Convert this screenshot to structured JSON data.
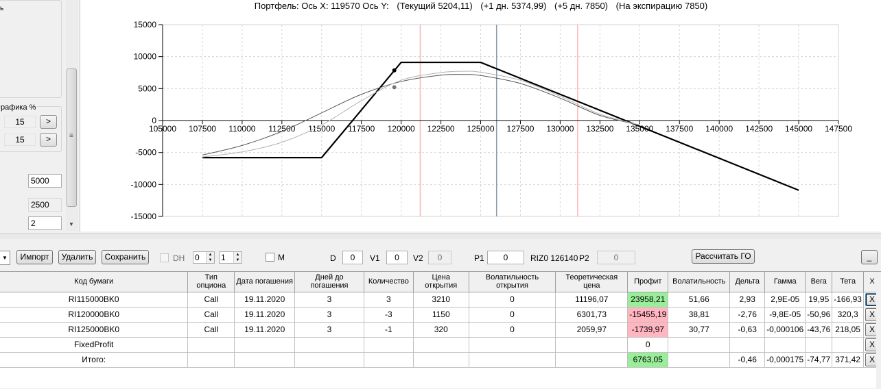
{
  "left_panel": {
    "truncated_label": "ь",
    "group_title": "рафика %",
    "row1_value": "15",
    "row2_value": "15",
    "arrow_label": ">",
    "input1": "5000",
    "input2": "2500",
    "input3": "2",
    "grip": "≡",
    "scroll_down": "▼"
  },
  "chart": {
    "title_parts": [
      "Портфель: Ось X: 119570 Ось Y:",
      "(Текущий 5204,11)",
      "(+1 дн. 5374,99)",
      "(+5 дн. 7850)",
      "(На экспирацию 7850)"
    ]
  },
  "chart_data": {
    "type": "line",
    "title": "Портфель: Ось X: 119570 Ось Y:  (Текущий 5204,11)  (+1 дн. 5374,99)  (+5 дн. 7850)  (На экспирацию 7850)",
    "xlim": [
      105000,
      147500
    ],
    "ylim": [
      -15000,
      15000
    ],
    "x_ticks": [
      "105000",
      "107500",
      "110000",
      "112500",
      "115000",
      "117500",
      "120000",
      "122500",
      "125000",
      "127500",
      "130000",
      "132500",
      "135000",
      "137500",
      "140000",
      "142500",
      "145000",
      "147500"
    ],
    "y_ticks": [
      "15000",
      "10000",
      "5000",
      "0",
      "-5000",
      "-10000",
      "-15000"
    ],
    "grid": true,
    "vertical_markers": [
      {
        "x": 121200,
        "color": "#ffb3b3"
      },
      {
        "x": 126000,
        "color": "#8899aa"
      },
      {
        "x": 131100,
        "color": "#ffb3b3"
      }
    ],
    "series": [
      {
        "color": "#000000",
        "width": 2.2,
        "x": [
          107500,
          115000,
          120000,
          125000,
          145000
        ],
        "y": [
          -5800,
          -5800,
          9100,
          9100,
          -10900
        ]
      },
      {
        "color": "#555555",
        "width": 1,
        "x": [
          107500,
          110000,
          112500,
          115000,
          117500,
          120000,
          122500,
          124000,
          125000,
          127500,
          130000,
          132500,
          135000
        ],
        "y": [
          -5400,
          -3900,
          -1700,
          1200,
          4100,
          6100,
          7100,
          7200,
          7050,
          5800,
          3500,
          800,
          -700
        ]
      },
      {
        "color": "#b0b0b0",
        "width": 1,
        "x": [
          107500,
          110000,
          112500,
          115000,
          117500,
          120000,
          122500,
          124000,
          125000,
          127500,
          130000,
          132500,
          135000
        ],
        "y": [
          -5700,
          -4900,
          -3400,
          -700,
          3100,
          6300,
          7500,
          7700,
          7550,
          6300,
          3800,
          1000,
          -700
        ]
      }
    ],
    "points": [
      {
        "x": 119570,
        "y": 7850,
        "color": "#000000"
      },
      {
        "x": 119570,
        "y": 5204.11,
        "color": "#777777"
      }
    ]
  },
  "toolbar": {
    "dropdown_arrow": "▼",
    "import": "Импорт",
    "delete": "Удалить",
    "save": "Сохранить",
    "dh_label": "DH",
    "spin1": "0",
    "spin2": "1",
    "spin_up": "▲",
    "spin_down": "▼",
    "m_label": "M",
    "d_label": "D",
    "d_value": "0",
    "v1_label": "V1",
    "v1_value": "0",
    "v2_label": "V2",
    "v2_value": "0",
    "p1_label": "P1",
    "p1_value": "0",
    "riz_label": "RIZ0 126140",
    "p2_label": "P2",
    "p2_value": "0",
    "calc": "Рассчитать ГО",
    "minimize": "_"
  },
  "table": {
    "headers": [
      "Код бумаги",
      "Тип опциона",
      "Дата погашения",
      "Дней до погашения",
      "Количество",
      "Цена открытия",
      "Волатильность открытия",
      "Теоретическая цена",
      "Профит",
      "Волатильность",
      "Дельта",
      "Гамма",
      "Вега",
      "Тета",
      "X"
    ],
    "rows": [
      [
        "RI115000BK0",
        "Call",
        "19.11.2020",
        "3",
        "3",
        "3210",
        "0",
        "11196,07",
        "23958,21",
        "51,66",
        "2,93",
        "2,9E-05",
        "19,95",
        "-166,93",
        "X"
      ],
      [
        "RI120000BK0",
        "Call",
        "19.11.2020",
        "3",
        "-3",
        "1150",
        "0",
        "6301,73",
        "-15455,19",
        "38,81",
        "-2,76",
        "-9,8E-05",
        "-50,96",
        "320,3",
        "X"
      ],
      [
        "RI125000BK0",
        "Call",
        "19.11.2020",
        "3",
        "-1",
        "320",
        "0",
        "2059,97",
        "-1739,97",
        "30,77",
        "-0,63",
        "-0,000106",
        "-43,76",
        "218,05",
        "X"
      ],
      [
        "FixedProfit",
        "",
        "",
        "",
        "",
        "",
        "",
        "",
        "0",
        "",
        "",
        "",
        "",
        "",
        "X"
      ],
      [
        "Итого:",
        "",
        "",
        "",
        "",
        "",
        "",
        "",
        "6763,05",
        "",
        "-0,46",
        "-0,000175",
        "-74,77",
        "371,42",
        "X"
      ]
    ],
    "profit_colors": {
      "positive": "#99ee99",
      "negative": "#ffb6c1"
    }
  }
}
